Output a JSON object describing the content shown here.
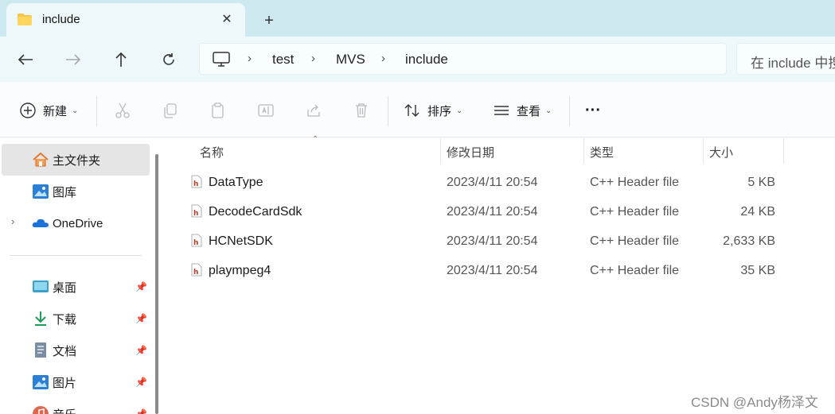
{
  "tab": {
    "title": "include",
    "close": "✕",
    "new_tab": "+"
  },
  "nav": {
    "breadcrumbs": [
      "test",
      "MVS",
      "include"
    ],
    "separator": "›",
    "search_placeholder": "在 include 中搜索"
  },
  "toolbar": {
    "new_label": "新建",
    "sort_label": "排序",
    "view_label": "查看",
    "more_label": "···"
  },
  "sidebar": {
    "items": [
      {
        "label": "主文件夹",
        "icon": "home-icon"
      },
      {
        "label": "图库",
        "icon": "gallery-icon"
      },
      {
        "label": "OneDrive",
        "icon": "onedrive-icon"
      },
      {
        "label": "桌面",
        "icon": "desktop-icon"
      },
      {
        "label": "下载",
        "icon": "download-icon"
      },
      {
        "label": "文档",
        "icon": "document-icon"
      },
      {
        "label": "图片",
        "icon": "pictures-icon"
      },
      {
        "label": "音乐",
        "icon": "music-icon"
      }
    ],
    "pin_glyph": "📌"
  },
  "columns": {
    "name": "名称",
    "modified": "修改日期",
    "type": "类型",
    "size": "大小"
  },
  "files": [
    {
      "name": "DataType",
      "modified": "2023/4/11 20:54",
      "type": "C++ Header file",
      "size": "5 KB"
    },
    {
      "name": "DecodeCardSdk",
      "modified": "2023/4/11 20:54",
      "type": "C++ Header file",
      "size": "24 KB"
    },
    {
      "name": "HCNetSDK",
      "modified": "2023/4/11 20:54",
      "type": "C++ Header file",
      "size": "2,633 KB"
    },
    {
      "name": "plaympeg4",
      "modified": "2023/4/11 20:54",
      "type": "C++ Header file",
      "size": "35 KB"
    }
  ],
  "watermark": "CSDN @Andy杨泽文",
  "colors": {
    "tabbar": "#cde9ef",
    "navrow": "#eef8fa",
    "accent": "#0067c0",
    "header_icon": "#c0392b"
  }
}
